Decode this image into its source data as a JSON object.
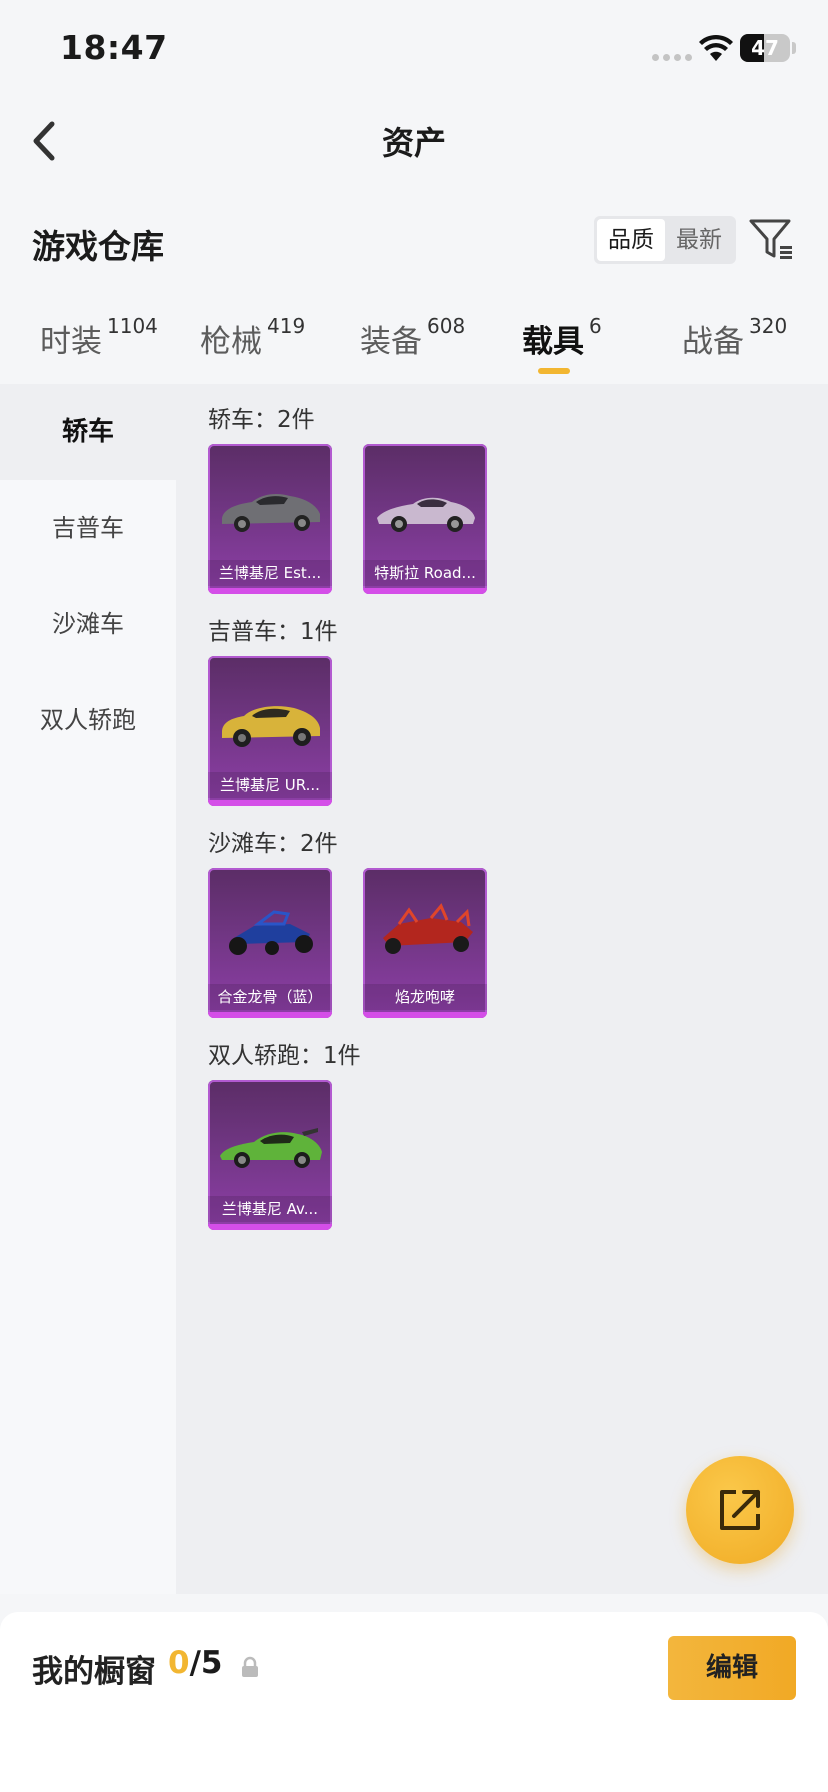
{
  "status_bar": {
    "time": "18:47",
    "battery": "47",
    "battery_level": 0.47
  },
  "header": {
    "title": "资产",
    "back_icon": "chevron-left-icon"
  },
  "warehouse": {
    "title": "游戏仓库",
    "sort_options": [
      "品质",
      "最新"
    ],
    "sort_selected": "品质",
    "filter_icon": "filter-icon"
  },
  "tabs": [
    {
      "label": "时装",
      "count": "1104"
    },
    {
      "label": "枪械",
      "count": "419"
    },
    {
      "label": "装备",
      "count": "608"
    },
    {
      "label": "载具",
      "count": "6",
      "active": true
    },
    {
      "label": "战备",
      "count": "320"
    }
  ],
  "sidebar": {
    "items": [
      "轿车",
      "吉普车",
      "沙滩车",
      "双人轿跑"
    ],
    "active": "轿车"
  },
  "groups": [
    {
      "title": "轿车：2件",
      "items": [
        {
          "name": "兰博基尼 Est..."
        },
        {
          "name": "特斯拉 Road..."
        }
      ]
    },
    {
      "title": "吉普车：1件",
      "items": [
        {
          "name": "兰博基尼 UR..."
        }
      ]
    },
    {
      "title": "沙滩车：2件",
      "items": [
        {
          "name": "合金龙骨（蓝）"
        },
        {
          "name": "焰龙咆哮"
        }
      ]
    },
    {
      "title": "双人轿跑：1件",
      "items": [
        {
          "name": "兰博基尼 Av..."
        }
      ]
    }
  ],
  "share_button": {
    "icon": "share-icon"
  },
  "bottom_bar": {
    "label": "我的橱窗",
    "current": "0",
    "separator": "/",
    "max": "5",
    "lock_icon": "lock-icon",
    "edit_label": "编辑"
  },
  "colors": {
    "accent": "#f2b631",
    "card_purple": "#8e3fa8",
    "card_edge": "#d44ee8"
  }
}
